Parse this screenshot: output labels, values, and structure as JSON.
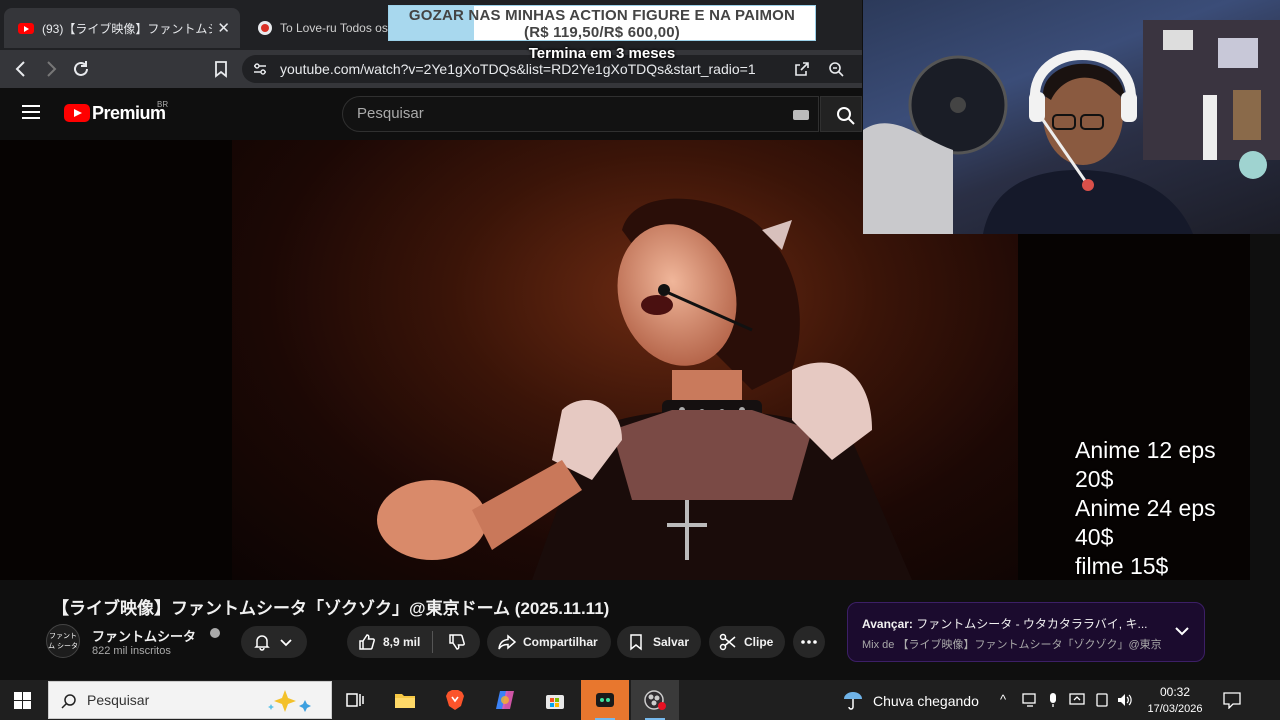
{
  "browser": {
    "tabs": [
      {
        "title": "(93)【ライブ映像】ファントムシータ「ゾク",
        "close": "✕"
      },
      {
        "title": "To Love-ru Todos os"
      }
    ],
    "url": "youtube.com/watch?v=2Ye1gXoTDQs&list=RD2Ye1gXoTDQs&start_radio=1"
  },
  "stream_overlay": {
    "goal_line1": "GOZAR NAS MINHAS ACTION FIGURE E NA PAIMON",
    "goal_line2": "(R$ 119,50/R$ 600,00)",
    "goal_progress": 0.2,
    "goal_subtitle": "Termina em 3 meses",
    "price_list": [
      "Anime 12 eps 20$",
      "Anime 24 eps 40$",
      "filme 15$"
    ],
    "colors": {
      "goal_fill": "#a8d8ee"
    }
  },
  "youtube": {
    "brand": "Premium",
    "region": "BR",
    "search_placeholder": "Pesquisar",
    "video_title": "【ライブ映像】ファントムシータ「ゾクゾク」@東京ドーム (2025.11.11)",
    "channel": {
      "avatar_text": "ファントム シータ",
      "name": "ファントムシータ",
      "subscribers": "822 mil inscritos"
    },
    "actions": {
      "likes": "8,9 mil",
      "share": "Compartilhar",
      "save": "Salvar",
      "clip": "Clipe"
    },
    "up_next": {
      "title_prefix": "Avançar:",
      "title": "ファントムシータ - ウタカタララバイ, キ...",
      "subtitle": "Mix de 【ライブ映像】ファントムシータ「ゾクゾク」@東京ドーム"
    }
  },
  "taskbar": {
    "search_placeholder": "Pesquisar",
    "weather": "Chuva chegando",
    "time": "00:32",
    "date": "17/03/2026"
  }
}
